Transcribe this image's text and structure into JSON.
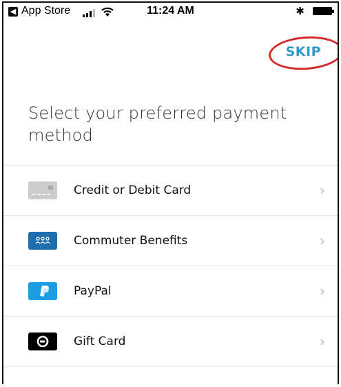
{
  "statusbar": {
    "back_app": "App Store",
    "time": "11:24 AM",
    "bluetooth": "✱"
  },
  "header": {
    "skip_label": "SKIP",
    "skip_color": "#2e9ac8",
    "highlight_color": "#d42a2a"
  },
  "title": "Select your preferred payment method",
  "payment_methods": [
    {
      "label": "Credit or Debit Card",
      "icon": "credit-card-icon",
      "icon_color": "#cccccc"
    },
    {
      "label": "Commuter Benefits",
      "icon": "commuter-benefits-icon",
      "icon_color": "#1f6fae"
    },
    {
      "label": "PayPal",
      "icon": "paypal-icon",
      "icon_color": "#1d9be3"
    },
    {
      "label": "Gift Card",
      "icon": "gift-card-icon",
      "icon_color": "#000000"
    }
  ],
  "chevron": "›"
}
